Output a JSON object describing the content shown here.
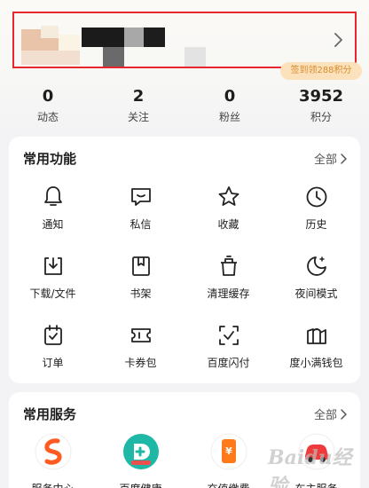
{
  "profile": {
    "points_tip": "签到领288积分"
  },
  "stats": [
    {
      "value": "0",
      "label": "动态"
    },
    {
      "value": "2",
      "label": "关注"
    },
    {
      "value": "0",
      "label": "粉丝"
    },
    {
      "value": "3952",
      "label": "积分"
    }
  ],
  "features": {
    "title": "常用功能",
    "all": "全部",
    "items": [
      {
        "label": "通知",
        "icon": "bell-icon"
      },
      {
        "label": "私信",
        "icon": "message-icon"
      },
      {
        "label": "收藏",
        "icon": "star-icon"
      },
      {
        "label": "历史",
        "icon": "clock-icon"
      },
      {
        "label": "下载/文件",
        "icon": "download-icon"
      },
      {
        "label": "书架",
        "icon": "bookshelf-icon"
      },
      {
        "label": "清理缓存",
        "icon": "trash-icon"
      },
      {
        "label": "夜间模式",
        "icon": "moon-icon"
      },
      {
        "label": "订单",
        "icon": "order-icon"
      },
      {
        "label": "卡券包",
        "icon": "coupon-icon"
      },
      {
        "label": "百度闪付",
        "icon": "scan-pay-icon"
      },
      {
        "label": "度小满钱包",
        "icon": "wallet-icon"
      }
    ]
  },
  "services": {
    "title": "常用服务",
    "all": "全部",
    "items": [
      {
        "label": "服务中心",
        "icon": "service-center-icon"
      },
      {
        "label": "百度健康",
        "icon": "health-icon"
      },
      {
        "label": "充值缴费",
        "icon": "recharge-icon"
      },
      {
        "label": "车主服务",
        "icon": "car-icon"
      }
    ]
  },
  "watermark": "Baidu经验",
  "colors": {
    "highlight_border": "#e8262c",
    "tip_bg": "#fbe2bc",
    "tip_text": "#d98b2a"
  }
}
